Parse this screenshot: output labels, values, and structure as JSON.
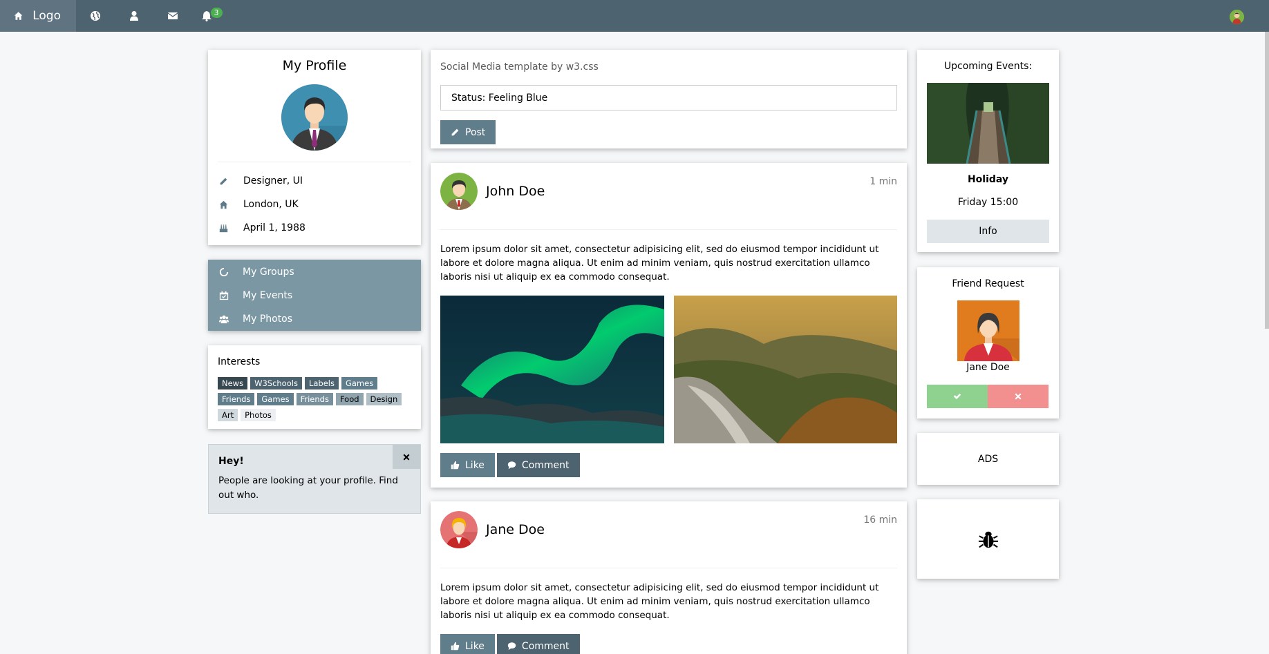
{
  "topbar": {
    "logo_label": "Logo",
    "notifications_count": "3",
    "icons": [
      "home-icon",
      "globe-icon",
      "user-icon",
      "envelope-icon",
      "bell-icon"
    ]
  },
  "profile": {
    "title": "My Profile",
    "job": "Designer, UI",
    "location": "London, UK",
    "birthday": "April 1, 1988"
  },
  "menu": {
    "groups": "My Groups",
    "events": "My Events",
    "photos": "My Photos"
  },
  "interests": {
    "title": "Interests",
    "tags": [
      "News",
      "W3Schools",
      "Labels",
      "Games",
      "Friends",
      "Games",
      "Friends",
      "Food",
      "Design",
      "Art",
      "Photos"
    ]
  },
  "alert": {
    "title": "Hey!",
    "text": "People are looking at your profile. Find out who.",
    "close_label": "×"
  },
  "composer": {
    "heading": "Social Media template by w3.css",
    "status_value": "Status: Feeling Blue",
    "post_label": "Post"
  },
  "posts": [
    {
      "name": "John Doe",
      "time": "1 min",
      "text": "Lorem ipsum dolor sit amet, consectetur adipisicing elit, sed do eiusmod tempor incididunt ut labore et dolore magna aliqua. Ut enim ad minim veniam, quis nostrud exercitation ullamco laboris nisi ut aliquip ex ea commodo consequat.",
      "like_label": "Like",
      "comment_label": "Comment"
    },
    {
      "name": "Jane Doe",
      "time": "16 min",
      "text": "Lorem ipsum dolor sit amet, consectetur adipisicing elit, sed do eiusmod tempor incididunt ut labore et dolore magna aliqua. Ut enim ad minim veniam, quis nostrud exercitation ullamco laboris nisi ut aliquip ex ea commodo consequat.",
      "like_label": "Like",
      "comment_label": "Comment"
    }
  ],
  "events": {
    "title": "Upcoming Events:",
    "name": "Holiday",
    "when": "Friday 15:00",
    "info_label": "Info"
  },
  "friend_request": {
    "title": "Friend Request",
    "name": "Jane Doe"
  },
  "ads": {
    "label": "ADS"
  },
  "colors": {
    "topbar": "#4d636f",
    "menu": "#7b97a3",
    "button": "#607d8b",
    "accept": "#8fd18f",
    "decline": "#f29090"
  }
}
